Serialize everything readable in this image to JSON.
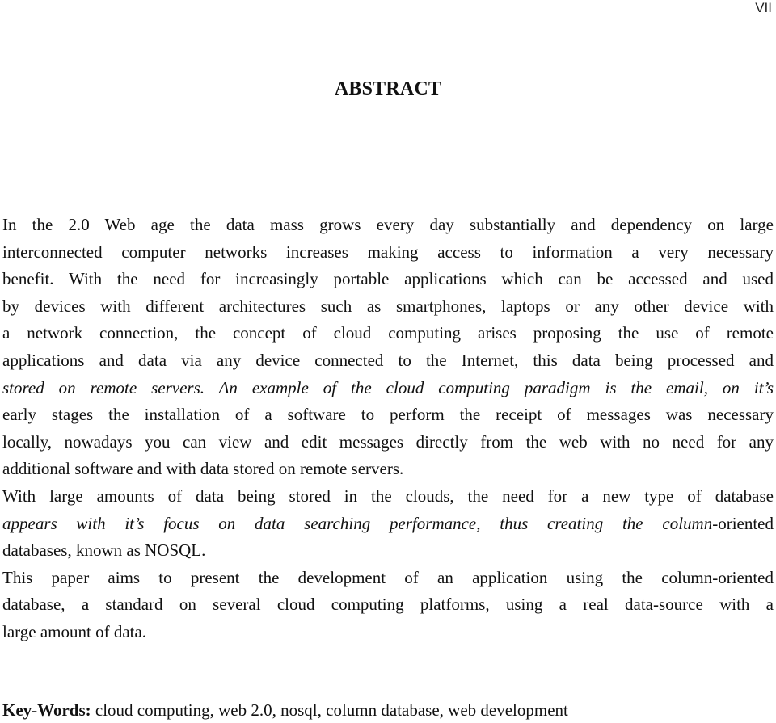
{
  "page_number": "VII",
  "title": "ABSTRACT",
  "paragraphs": [
    {
      "lines": [
        {
          "segments": [
            {
              "text": "In the 2.0 Web age the data mass grows every day substantially and dependency on large",
              "italic": false
            }
          ]
        },
        {
          "segments": [
            {
              "text": "interconnected computer networks increases making access to information a very necessary",
              "italic": false
            }
          ]
        },
        {
          "segments": [
            {
              "text": "benefit. With the need for increasingly portable applications which can be accessed and used",
              "italic": false
            }
          ]
        },
        {
          "segments": [
            {
              "text": "by devices with different architectures such as smartphones, laptops or any other device with",
              "italic": false
            }
          ]
        },
        {
          "segments": [
            {
              "text": "a network connection, the concept of cloud computing arises proposing the use of remote",
              "italic": false
            }
          ]
        },
        {
          "segments": [
            {
              "text": "applications and data via any device connected to the Internet, this data being processed and",
              "italic": false
            }
          ]
        },
        {
          "segments": [
            {
              "text": "stored on remote servers. An example of the cloud computing paradigm is the email, on it’s",
              "italic": true
            }
          ]
        },
        {
          "segments": [
            {
              "text": "early stages the installation of a software to perform the receipt of messages was necessary",
              "italic": false
            }
          ]
        },
        {
          "segments": [
            {
              "text": "locally, nowadays you can view and edit messages directly from the web with no need for any",
              "italic": false
            }
          ]
        },
        {
          "segments": [
            {
              "text": "additional software and with data stored on remote servers.",
              "italic": false
            }
          ],
          "last": true
        }
      ]
    },
    {
      "lines": [
        {
          "segments": [
            {
              "text": "With large amounts of data being stored in the clouds, the need for a new type of database",
              "italic": false
            }
          ]
        },
        {
          "segments": [
            {
              "text": "appears with it’s focus on data searching performance, thus creating the column",
              "italic": true
            },
            {
              "text": "-oriented",
              "italic": false
            }
          ]
        },
        {
          "segments": [
            {
              "text": "databases, known as NOSQL.",
              "italic": false
            }
          ],
          "last": true
        }
      ]
    },
    {
      "lines": [
        {
          "segments": [
            {
              "text": "This paper aims to present the development of an application using the column-oriented",
              "italic": false
            }
          ]
        },
        {
          "segments": [
            {
              "text": "database, a standard on several cloud computing platforms, using a real data-source with a",
              "italic": false
            }
          ]
        },
        {
          "segments": [
            {
              "text": "large amount of data.",
              "italic": false
            }
          ],
          "last": true
        }
      ]
    }
  ],
  "keywords": {
    "label": "Key-Words:",
    "value": " cloud computing, web 2.0, nosql, column database, web development"
  }
}
